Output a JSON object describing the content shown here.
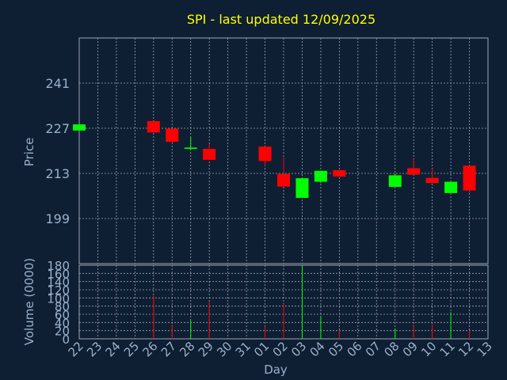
{
  "chart_data": [
    {
      "type": "candlestick",
      "title": "SPI - last updated 12/09/2025",
      "xlabel": "Day",
      "ylabel": "Price",
      "yticks": [
        199,
        213,
        227,
        241
      ],
      "ylim": [
        185,
        255
      ],
      "grid": true,
      "x": [
        "22",
        "23",
        "24",
        "25",
        "26",
        "27",
        "28",
        "29",
        "30",
        "31",
        "01",
        "02",
        "03",
        "04",
        "05",
        "06",
        "07",
        "08",
        "09",
        "10",
        "11",
        "12",
        "13"
      ],
      "candles": [
        {
          "day": "22",
          "open": 226.3,
          "close": 228.2,
          "high": 228.2,
          "low": 226.3
        },
        {
          "day": "26",
          "open": 229.2,
          "close": 225.7,
          "high": 229.2,
          "low": 225.7
        },
        {
          "day": "27",
          "open": 226.9,
          "close": 222.8,
          "high": 226.9,
          "low": 222.4
        },
        {
          "day": "28",
          "open": 220.6,
          "close": 221.0,
          "high": 224.2,
          "low": 220.3
        },
        {
          "day": "29",
          "open": 220.6,
          "close": 217.2,
          "high": 222.1,
          "low": 217.2
        },
        {
          "day": "01",
          "open": 221.3,
          "close": 216.8,
          "high": 221.3,
          "low": 215.3
        },
        {
          "day": "02",
          "open": 212.8,
          "close": 208.9,
          "high": 218.0,
          "low": 208.9
        },
        {
          "day": "03",
          "open": 205.4,
          "close": 211.5,
          "high": 211.5,
          "low": 205.4
        },
        {
          "day": "04",
          "open": 210.4,
          "close": 213.8,
          "high": 213.8,
          "low": 210.0
        },
        {
          "day": "05",
          "open": 214.0,
          "close": 212.0,
          "high": 214.0,
          "low": 212.0
        },
        {
          "day": "08",
          "open": 208.8,
          "close": 212.4,
          "high": 213.0,
          "low": 208.8
        },
        {
          "day": "09",
          "open": 214.6,
          "close": 212.6,
          "high": 217.4,
          "low": 212.6
        },
        {
          "day": "10",
          "open": 211.6,
          "close": 210.0,
          "high": 214.4,
          "low": 210.0
        },
        {
          "day": "11",
          "open": 206.9,
          "close": 210.4,
          "high": 210.4,
          "low": 206.9
        },
        {
          "day": "12",
          "open": 215.4,
          "close": 207.7,
          "high": 215.4,
          "low": 207.0
        }
      ],
      "colors": {
        "up": "#00ff00",
        "down": "#ff0000"
      }
    },
    {
      "type": "bar",
      "ylabel": "Volume (0000)",
      "xlabel": "Day",
      "ylim": [
        0,
        180
      ],
      "yticks": [
        0,
        20,
        40,
        60,
        80,
        100,
        120,
        140,
        160,
        180
      ],
      "categories": [
        "22",
        "23",
        "24",
        "25",
        "26",
        "27",
        "28",
        "29",
        "30",
        "31",
        "01",
        "02",
        "03",
        "04",
        "05",
        "06",
        "07",
        "08",
        "09",
        "10",
        "11",
        "12",
        "13"
      ],
      "values": [
        0,
        0,
        0,
        0,
        105,
        35,
        45,
        90,
        0,
        0,
        30,
        85,
        180,
        55,
        20,
        0,
        0,
        25,
        35,
        35,
        65,
        20,
        0
      ],
      "bar_colors": [
        "#ff0000",
        "#ff0000",
        "#ff0000",
        "#ff0000",
        "#ff0000",
        "#ff0000",
        "#00ff00",
        "#ff0000",
        "#ff0000",
        "#ff0000",
        "#ff0000",
        "#ff0000",
        "#00ff00",
        "#00ff00",
        "#ff0000",
        "#ff0000",
        "#ff0000",
        "#00ff00",
        "#ff0000",
        "#ff0000",
        "#00ff00",
        "#ff0000",
        "#ff0000"
      ]
    }
  ],
  "colors": {
    "background": "#0f1f33",
    "plot_background": "#0f1f33",
    "grid": "#9aa4b0",
    "frame": "#9aa4b0",
    "text": "#9ab0c8",
    "title": "#ffff00"
  }
}
